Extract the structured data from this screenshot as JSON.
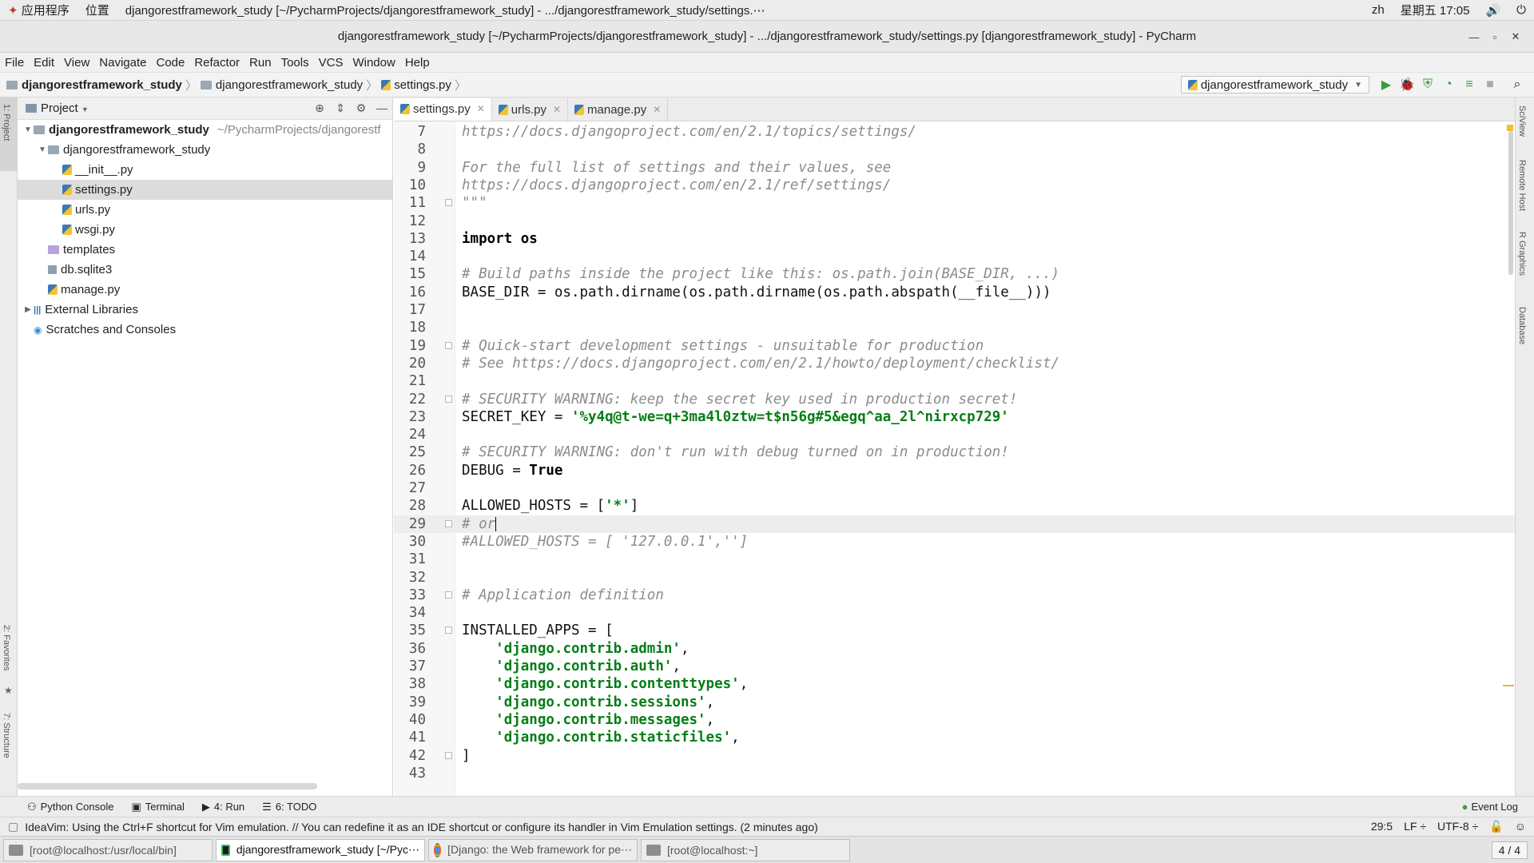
{
  "system_bar": {
    "apps_label": "应用程序",
    "places_label": "位置",
    "window_title": "djangorestframework_study [~/PycharmProjects/djangorestframework_study] - .../djangorestframework_study/settings.⋯",
    "lang": "zh",
    "datetime": "星期五 17:05"
  },
  "title_bar": {
    "title": "djangorestframework_study [~/PycharmProjects/djangorestframework_study] - .../djangorestframework_study/settings.py [djangorestframework_study] - PyCharm"
  },
  "menu": [
    "File",
    "Edit",
    "View",
    "Navigate",
    "Code",
    "Refactor",
    "Run",
    "Tools",
    "VCS",
    "Window",
    "Help"
  ],
  "breadcrumb": {
    "root": "djangorestframework_study",
    "folder": "djangorestframework_study",
    "file": "settings.py"
  },
  "run_config": "djangorestframework_study",
  "side_labels": {
    "left_top": "1: Project",
    "left_mid": "2: Favorites",
    "left_bottom": "7: Structure",
    "right_1": "SciView",
    "right_2": "Remote Host",
    "right_3": "R Graphics",
    "right_4": "Database"
  },
  "project_panel": {
    "title": "Project",
    "tree": [
      {
        "label": "djangorestframework_study",
        "extra": "~/PycharmProjects/djangorestf",
        "indent": 0,
        "arrow": "down",
        "icon": "folder",
        "bold": true
      },
      {
        "label": "djangorestframework_study",
        "indent": 1,
        "arrow": "down",
        "icon": "folder"
      },
      {
        "label": "__init__.py",
        "indent": 2,
        "icon": "py"
      },
      {
        "label": "settings.py",
        "indent": 2,
        "icon": "py",
        "selected": true
      },
      {
        "label": "urls.py",
        "indent": 2,
        "icon": "py"
      },
      {
        "label": "wsgi.py",
        "indent": 2,
        "icon": "py"
      },
      {
        "label": "templates",
        "indent": 1,
        "icon": "folder-purple"
      },
      {
        "label": "db.sqlite3",
        "indent": 1,
        "icon": "db"
      },
      {
        "label": "manage.py",
        "indent": 1,
        "icon": "py"
      },
      {
        "label": "External Libraries",
        "indent": 0,
        "arrow": "right",
        "icon": "libs"
      },
      {
        "label": "Scratches and Consoles",
        "indent": 0,
        "icon": "scratch"
      }
    ]
  },
  "tabs": [
    {
      "label": "settings.py",
      "active": true
    },
    {
      "label": "urls.py",
      "active": false
    },
    {
      "label": "manage.py",
      "active": false
    }
  ],
  "code_lines": [
    {
      "n": "7",
      "parts": [
        {
          "t": "https://docs.djangoproject.com/en/2.1/topics/settings/",
          "c": "cm"
        }
      ]
    },
    {
      "n": "8",
      "parts": []
    },
    {
      "n": "9",
      "parts": [
        {
          "t": "For the full list of settings and their values, see",
          "c": "cm"
        }
      ]
    },
    {
      "n": "10",
      "parts": [
        {
          "t": "https://docs.djangoproject.com/en/2.1/ref/settings/",
          "c": "cm"
        }
      ]
    },
    {
      "n": "11",
      "fold": true,
      "parts": [
        {
          "t": "\"\"\"",
          "c": "cm"
        }
      ]
    },
    {
      "n": "12",
      "parts": []
    },
    {
      "n": "13",
      "parts": [
        {
          "t": "import",
          "c": "kw"
        },
        {
          "t": " os",
          "c": "kw"
        }
      ]
    },
    {
      "n": "14",
      "parts": []
    },
    {
      "n": "15",
      "parts": [
        {
          "t": "# Build paths inside the project like this: os.path.join(BASE_DIR, ...)",
          "c": "cm"
        }
      ]
    },
    {
      "n": "16",
      "parts": [
        {
          "t": "BASE_DIR = os.path.dirname(os.path.dirname(os.path.abspath(__file__)))",
          "c": ""
        }
      ]
    },
    {
      "n": "17",
      "parts": []
    },
    {
      "n": "18",
      "parts": []
    },
    {
      "n": "19",
      "fold": true,
      "parts": [
        {
          "t": "# Quick-start development settings - unsuitable for production",
          "c": "cm"
        }
      ]
    },
    {
      "n": "20",
      "parts": [
        {
          "t": "# See https://docs.djangoproject.com/en/2.1/howto/deployment/checklist/",
          "c": "cm"
        }
      ]
    },
    {
      "n": "21",
      "parts": []
    },
    {
      "n": "22",
      "fold": true,
      "parts": [
        {
          "t": "# SECURITY WARNING: keep the secret key used in production secret!",
          "c": "cm"
        }
      ]
    },
    {
      "n": "23",
      "parts": [
        {
          "t": "SECRET_KEY = ",
          "c": ""
        },
        {
          "t": "'%y4q@t-we=q+3ma4l0ztw=t$n56g#5&egq^aa_2l^nirxcp729'",
          "c": "st"
        }
      ]
    },
    {
      "n": "24",
      "parts": []
    },
    {
      "n": "25",
      "parts": [
        {
          "t": "# SECURITY WARNING: don't run with debug turned on in production!",
          "c": "cm"
        }
      ]
    },
    {
      "n": "26",
      "parts": [
        {
          "t": "DEBUG = ",
          "c": ""
        },
        {
          "t": "True",
          "c": "kw"
        }
      ]
    },
    {
      "n": "27",
      "parts": []
    },
    {
      "n": "28",
      "parts": [
        {
          "t": "ALLOWED_HOSTS = [",
          "c": ""
        },
        {
          "t": "'*'",
          "c": "st"
        },
        {
          "t": "]",
          "c": ""
        }
      ]
    },
    {
      "n": "29",
      "fold": true,
      "current": true,
      "parts": [
        {
          "t": "# or",
          "c": "cm"
        }
      ]
    },
    {
      "n": "30",
      "parts": [
        {
          "t": "#ALLOWED_HOSTS = [ '127.0.0.1','']",
          "c": "cm"
        }
      ]
    },
    {
      "n": "31",
      "parts": []
    },
    {
      "n": "32",
      "parts": []
    },
    {
      "n": "33",
      "fold": true,
      "parts": [
        {
          "t": "# Application definition",
          "c": "cm"
        }
      ]
    },
    {
      "n": "34",
      "parts": []
    },
    {
      "n": "35",
      "fold": true,
      "parts": [
        {
          "t": "INSTALLED_APPS = [",
          "c": ""
        }
      ]
    },
    {
      "n": "36",
      "parts": [
        {
          "t": "    ",
          "c": ""
        },
        {
          "t": "'django.contrib.admin'",
          "c": "st"
        },
        {
          "t": ",",
          "c": ""
        }
      ]
    },
    {
      "n": "37",
      "parts": [
        {
          "t": "    ",
          "c": ""
        },
        {
          "t": "'django.contrib.auth'",
          "c": "st"
        },
        {
          "t": ",",
          "c": ""
        }
      ]
    },
    {
      "n": "38",
      "parts": [
        {
          "t": "    ",
          "c": ""
        },
        {
          "t": "'django.contrib.contenttypes'",
          "c": "st"
        },
        {
          "t": ",",
          "c": ""
        }
      ]
    },
    {
      "n": "39",
      "parts": [
        {
          "t": "    ",
          "c": ""
        },
        {
          "t": "'django.contrib.sessions'",
          "c": "st"
        },
        {
          "t": ",",
          "c": ""
        }
      ]
    },
    {
      "n": "40",
      "parts": [
        {
          "t": "    ",
          "c": ""
        },
        {
          "t": "'django.contrib.messages'",
          "c": "st"
        },
        {
          "t": ",",
          "c": ""
        }
      ]
    },
    {
      "n": "41",
      "parts": [
        {
          "t": "    ",
          "c": ""
        },
        {
          "t": "'django.contrib.staticfiles'",
          "c": "st"
        },
        {
          "t": ",",
          "c": ""
        }
      ]
    },
    {
      "n": "42",
      "fold": true,
      "parts": [
        {
          "t": "]",
          "c": ""
        }
      ]
    },
    {
      "n": "43",
      "parts": []
    }
  ],
  "tool_windows": [
    {
      "label": "Python Console",
      "icon": "python-console-icon"
    },
    {
      "label": "Terminal",
      "icon": "terminal-icon"
    },
    {
      "label": "4: Run",
      "icon": "run-icon"
    },
    {
      "label": "6: TODO",
      "icon": "todo-icon"
    }
  ],
  "event_log": "Event Log",
  "status": {
    "message": "IdeaVim: Using the Ctrl+F shortcut for Vim emulation. // You can redefine it as an IDE shortcut or configure its handler in Vim Emulation settings. (2 minutes ago)",
    "position": "29:5",
    "line_sep": "LF ÷",
    "encoding": "UTF-8 ÷"
  },
  "taskbar": {
    "items": [
      {
        "label": "[root@localhost:/usr/local/bin]",
        "icon": "terminal",
        "active": false
      },
      {
        "label": "djangorestframework_study [~/Pyc⋯",
        "icon": "pycharm",
        "active": true
      },
      {
        "label": "[Django: the Web framework for pe⋯",
        "icon": "chrome",
        "active": false
      },
      {
        "label": "[root@localhost:~]",
        "icon": "terminal",
        "active": false
      }
    ],
    "pager": "4 / 4"
  },
  "colors": {
    "string": "#067d17",
    "comment": "#8c8c8c",
    "current_line": "#ededed",
    "selection": "#dcdcdc"
  }
}
